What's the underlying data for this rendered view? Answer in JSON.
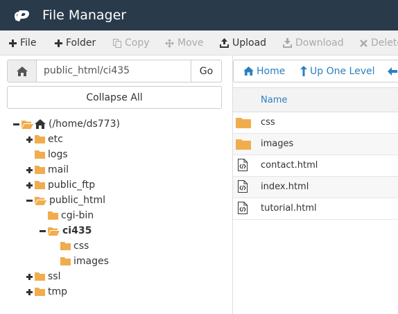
{
  "app": {
    "title": "File Manager",
    "logo": "cpanel-logo"
  },
  "toolbar": {
    "file": "File",
    "folder": "Folder",
    "copy": "Copy",
    "move": "Move",
    "upload": "Upload",
    "download": "Download",
    "delete": "Delete"
  },
  "path": {
    "value": "public_html/ci435",
    "go": "Go"
  },
  "collapse_all": "Collapse All",
  "tree": {
    "root": "(/home/ds773)",
    "etc": "etc",
    "logs": "logs",
    "mail": "mail",
    "public_ftp": "public_ftp",
    "public_html": "public_html",
    "cgi_bin": "cgi-bin",
    "ci435": "ci435",
    "css": "css",
    "images": "images",
    "ssl": "ssl",
    "tmp": "tmp"
  },
  "nav": {
    "home": "Home",
    "up": "Up One Level"
  },
  "table": {
    "name_header": "Name",
    "files": [
      {
        "name": "css",
        "type": "folder"
      },
      {
        "name": "images",
        "type": "folder"
      },
      {
        "name": "contact.html",
        "type": "html"
      },
      {
        "name": "index.html",
        "type": "html"
      },
      {
        "name": "tutorial.html",
        "type": "html"
      }
    ]
  },
  "colors": {
    "header_bg": "#293a4a",
    "toolbar_bg": "#f0f0f0",
    "link": "#2a7fc1",
    "folder": "#f0ad4e",
    "disabled": "#aaaaaa"
  }
}
